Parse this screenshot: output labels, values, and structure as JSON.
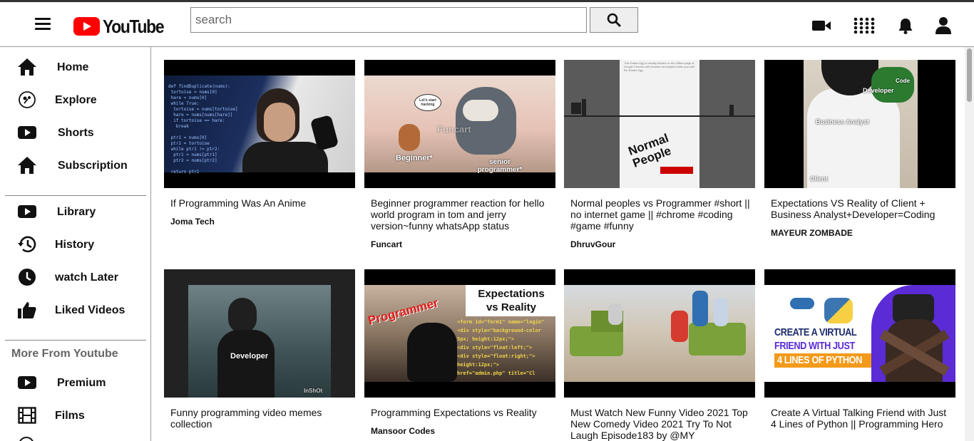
{
  "app": {
    "logo_text": "YouTube"
  },
  "search": {
    "placeholder": "search"
  },
  "header_icons": [
    "video-camera-icon",
    "apps-grid-icon",
    "bell-icon",
    "account-icon"
  ],
  "sidebar": {
    "main": [
      {
        "label": "Home",
        "icon": "home-icon"
      },
      {
        "label": "Explore",
        "icon": "explore-icon"
      },
      {
        "label": "Shorts",
        "icon": "shorts-icon"
      },
      {
        "label": "Subscription",
        "icon": "subscription-icon"
      }
    ],
    "library": [
      {
        "label": "Library",
        "icon": "library-icon"
      },
      {
        "label": "History",
        "icon": "history-icon"
      },
      {
        "label": "watch Later",
        "icon": "clock-icon"
      },
      {
        "label": "Liked Videos",
        "icon": "thumbs-up-icon"
      }
    ],
    "more_title": "More From Youtube",
    "more": [
      {
        "label": "Premium",
        "icon": "premium-icon"
      },
      {
        "label": "Films",
        "icon": "film-icon"
      }
    ]
  },
  "videos": [
    {
      "title": "If Programming Was An Anime",
      "channel": "Joma Tech",
      "thumb_text": ""
    },
    {
      "title": "Beginner programmer reaction for hello world program in tom and jerry version~funny whatsApp status",
      "channel": "Funcart",
      "thumb_text": "Beginner*",
      "thumb_text2": "senior programmer*",
      "thumb_text3": "Funcart"
    },
    {
      "title": "Normal peoples vs Programmer #short || no internet game || #chrome #coding #game #funny",
      "channel": "DhruvGour",
      "thumb_text": "Normal People"
    },
    {
      "title": "Expectations VS Reality of Client + Business Analyst+Developer=Coding",
      "channel": "MAYEUR ZOMBADE",
      "thumb_text": "Business Analyst",
      "thumb_text2": "Developer",
      "thumb_text3": "Client",
      "thumb_text4": "Code"
    },
    {
      "title": "Funny programming video memes collection",
      "channel": "",
      "thumb_text": "Developer",
      "thumb_text2": "InShOt"
    },
    {
      "title": "Programming Expectations vs Reality",
      "channel": "Mansoor Codes",
      "thumb_text": "Programmer",
      "thumb_text2": "Expectations vs Reality"
    },
    {
      "title": "Must Watch New Funny Video 2021 Top New Comedy Video 2021 Try To Not Laugh Episode183 by @MY",
      "channel": "",
      "thumb_text": ""
    },
    {
      "title": "Create A Virtual Talking Friend with Just 4 Lines of Python || Programming Hero",
      "channel": "",
      "thumb_text": "CREATE A VIRTUAL",
      "thumb_text2": "FRIEND WITH JUST",
      "thumb_text3": "4 LINES OF PYTHON"
    }
  ]
}
